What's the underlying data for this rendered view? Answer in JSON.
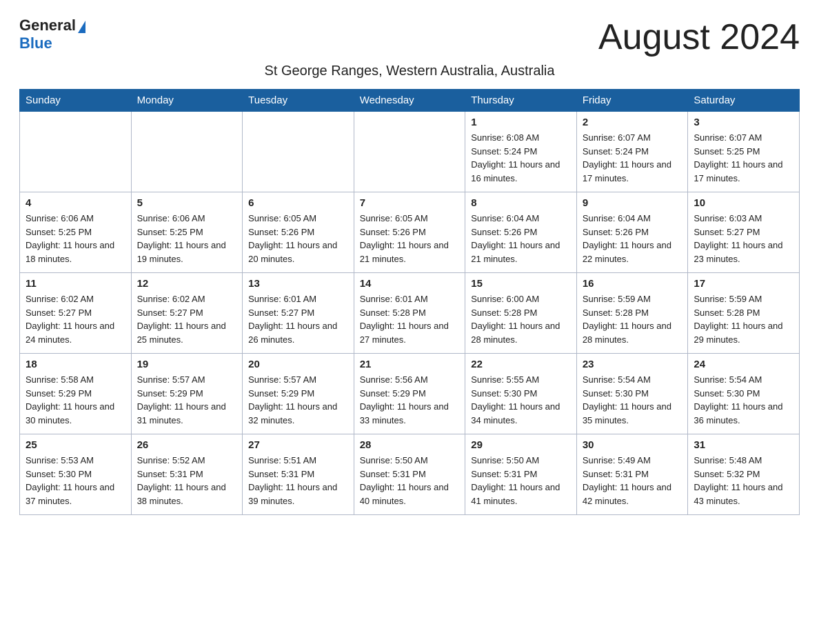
{
  "header": {
    "logo_general": "General",
    "logo_blue": "Blue",
    "month_title": "August 2024",
    "location": "St George Ranges, Western Australia, Australia"
  },
  "days_of_week": [
    "Sunday",
    "Monday",
    "Tuesday",
    "Wednesday",
    "Thursday",
    "Friday",
    "Saturday"
  ],
  "weeks": [
    [
      {
        "day": "",
        "info": ""
      },
      {
        "day": "",
        "info": ""
      },
      {
        "day": "",
        "info": ""
      },
      {
        "day": "",
        "info": ""
      },
      {
        "day": "1",
        "info": "Sunrise: 6:08 AM\nSunset: 5:24 PM\nDaylight: 11 hours and 16 minutes."
      },
      {
        "day": "2",
        "info": "Sunrise: 6:07 AM\nSunset: 5:24 PM\nDaylight: 11 hours and 17 minutes."
      },
      {
        "day": "3",
        "info": "Sunrise: 6:07 AM\nSunset: 5:25 PM\nDaylight: 11 hours and 17 minutes."
      }
    ],
    [
      {
        "day": "4",
        "info": "Sunrise: 6:06 AM\nSunset: 5:25 PM\nDaylight: 11 hours and 18 minutes."
      },
      {
        "day": "5",
        "info": "Sunrise: 6:06 AM\nSunset: 5:25 PM\nDaylight: 11 hours and 19 minutes."
      },
      {
        "day": "6",
        "info": "Sunrise: 6:05 AM\nSunset: 5:26 PM\nDaylight: 11 hours and 20 minutes."
      },
      {
        "day": "7",
        "info": "Sunrise: 6:05 AM\nSunset: 5:26 PM\nDaylight: 11 hours and 21 minutes."
      },
      {
        "day": "8",
        "info": "Sunrise: 6:04 AM\nSunset: 5:26 PM\nDaylight: 11 hours and 21 minutes."
      },
      {
        "day": "9",
        "info": "Sunrise: 6:04 AM\nSunset: 5:26 PM\nDaylight: 11 hours and 22 minutes."
      },
      {
        "day": "10",
        "info": "Sunrise: 6:03 AM\nSunset: 5:27 PM\nDaylight: 11 hours and 23 minutes."
      }
    ],
    [
      {
        "day": "11",
        "info": "Sunrise: 6:02 AM\nSunset: 5:27 PM\nDaylight: 11 hours and 24 minutes."
      },
      {
        "day": "12",
        "info": "Sunrise: 6:02 AM\nSunset: 5:27 PM\nDaylight: 11 hours and 25 minutes."
      },
      {
        "day": "13",
        "info": "Sunrise: 6:01 AM\nSunset: 5:27 PM\nDaylight: 11 hours and 26 minutes."
      },
      {
        "day": "14",
        "info": "Sunrise: 6:01 AM\nSunset: 5:28 PM\nDaylight: 11 hours and 27 minutes."
      },
      {
        "day": "15",
        "info": "Sunrise: 6:00 AM\nSunset: 5:28 PM\nDaylight: 11 hours and 28 minutes."
      },
      {
        "day": "16",
        "info": "Sunrise: 5:59 AM\nSunset: 5:28 PM\nDaylight: 11 hours and 28 minutes."
      },
      {
        "day": "17",
        "info": "Sunrise: 5:59 AM\nSunset: 5:28 PM\nDaylight: 11 hours and 29 minutes."
      }
    ],
    [
      {
        "day": "18",
        "info": "Sunrise: 5:58 AM\nSunset: 5:29 PM\nDaylight: 11 hours and 30 minutes."
      },
      {
        "day": "19",
        "info": "Sunrise: 5:57 AM\nSunset: 5:29 PM\nDaylight: 11 hours and 31 minutes."
      },
      {
        "day": "20",
        "info": "Sunrise: 5:57 AM\nSunset: 5:29 PM\nDaylight: 11 hours and 32 minutes."
      },
      {
        "day": "21",
        "info": "Sunrise: 5:56 AM\nSunset: 5:29 PM\nDaylight: 11 hours and 33 minutes."
      },
      {
        "day": "22",
        "info": "Sunrise: 5:55 AM\nSunset: 5:30 PM\nDaylight: 11 hours and 34 minutes."
      },
      {
        "day": "23",
        "info": "Sunrise: 5:54 AM\nSunset: 5:30 PM\nDaylight: 11 hours and 35 minutes."
      },
      {
        "day": "24",
        "info": "Sunrise: 5:54 AM\nSunset: 5:30 PM\nDaylight: 11 hours and 36 minutes."
      }
    ],
    [
      {
        "day": "25",
        "info": "Sunrise: 5:53 AM\nSunset: 5:30 PM\nDaylight: 11 hours and 37 minutes."
      },
      {
        "day": "26",
        "info": "Sunrise: 5:52 AM\nSunset: 5:31 PM\nDaylight: 11 hours and 38 minutes."
      },
      {
        "day": "27",
        "info": "Sunrise: 5:51 AM\nSunset: 5:31 PM\nDaylight: 11 hours and 39 minutes."
      },
      {
        "day": "28",
        "info": "Sunrise: 5:50 AM\nSunset: 5:31 PM\nDaylight: 11 hours and 40 minutes."
      },
      {
        "day": "29",
        "info": "Sunrise: 5:50 AM\nSunset: 5:31 PM\nDaylight: 11 hours and 41 minutes."
      },
      {
        "day": "30",
        "info": "Sunrise: 5:49 AM\nSunset: 5:31 PM\nDaylight: 11 hours and 42 minutes."
      },
      {
        "day": "31",
        "info": "Sunrise: 5:48 AM\nSunset: 5:32 PM\nDaylight: 11 hours and 43 minutes."
      }
    ]
  ]
}
